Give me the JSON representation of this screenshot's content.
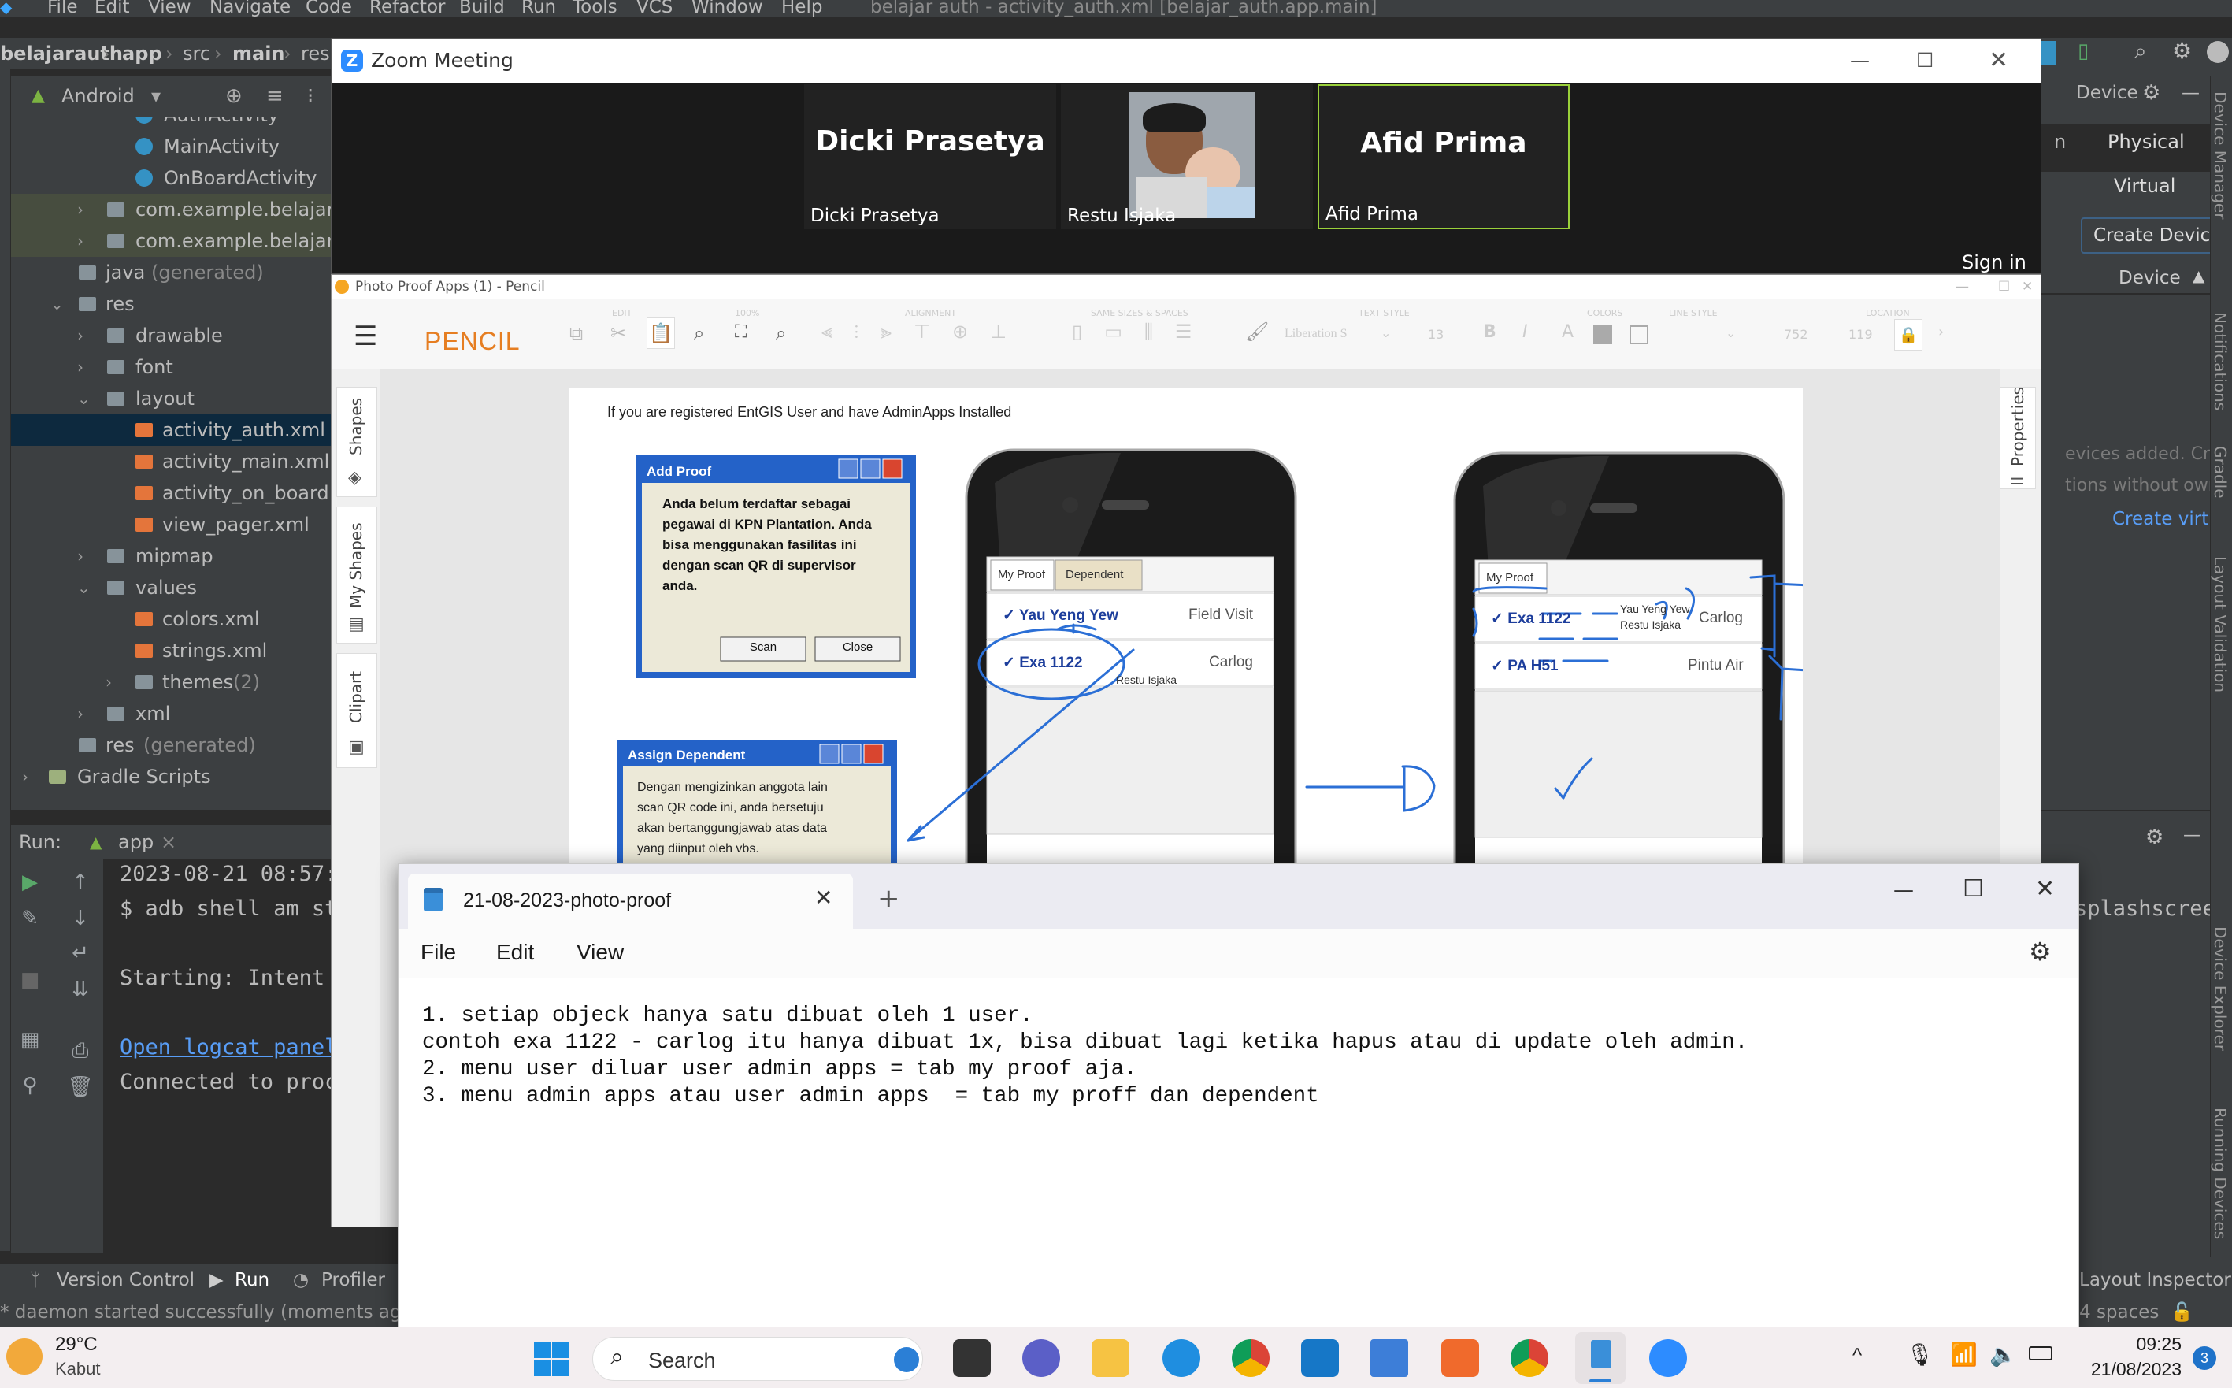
{
  "android_studio": {
    "menu": [
      "File",
      "Edit",
      "View",
      "Navigate",
      "Code",
      "Refactor",
      "Build",
      "Run",
      "Tools",
      "VCS",
      "Window",
      "Help"
    ],
    "window_title": "belajar auth - activity_auth.xml [belajar_auth.app.main]",
    "breadcrumb": [
      "belajarauth",
      "app",
      "src",
      "main",
      "res"
    ],
    "project_view": "Android",
    "tree": [
      {
        "label": "AuthActivity",
        "icon": "class-icon"
      },
      {
        "label": "MainActivity",
        "icon": "class-icon"
      },
      {
        "label": "OnBoardActivity",
        "icon": "class-icon"
      },
      {
        "label": "com.example.belajarauth",
        "icon": "folder-icon"
      },
      {
        "label": "com.example.belajarauth",
        "icon": "folder-icon"
      },
      {
        "label": "java",
        "suffix": "(generated)",
        "icon": "folder-icon"
      },
      {
        "label": "res",
        "icon": "folder-icon"
      },
      {
        "label": "drawable",
        "icon": "folder-icon"
      },
      {
        "label": "font",
        "icon": "folder-icon"
      },
      {
        "label": "layout",
        "icon": "folder-icon"
      },
      {
        "label": "activity_auth.xml",
        "icon": "xml-file-icon"
      },
      {
        "label": "activity_main.xml",
        "icon": "xml-file-icon"
      },
      {
        "label": "activity_on_board.xml",
        "icon": "xml-file-icon"
      },
      {
        "label": "view_pager.xml",
        "icon": "xml-file-icon"
      },
      {
        "label": "mipmap",
        "icon": "folder-icon"
      },
      {
        "label": "values",
        "icon": "folder-icon"
      },
      {
        "label": "colors.xml",
        "icon": "xml-file-icon"
      },
      {
        "label": "strings.xml",
        "icon": "xml-file-icon"
      },
      {
        "label": "themes",
        "suffix": "(2)",
        "icon": "folder-icon"
      },
      {
        "label": "xml",
        "icon": "folder-icon"
      },
      {
        "label": "res",
        "suffix": "(generated)",
        "icon": "folder-icon"
      },
      {
        "label": "Gradle Scripts",
        "icon": "gradle-icon"
      }
    ],
    "run": {
      "label": "Run:",
      "config": "app"
    },
    "console": [
      "2023-08-21 08:57:",
      "$ adb shell am st",
      "Starting: Intent",
      "Open logcat panel",
      "Connected to proc"
    ],
    "console_right": "splashscree",
    "bottom_tabs": [
      "Version Control",
      "Run",
      "Profiler"
    ],
    "bottom_right": "Layout Inspector",
    "status": "* daemon started successfully (moments ago)",
    "status_right": "4 spaces",
    "device_manager": {
      "title": "Device",
      "tabs": [
        "Physical",
        "Virtual"
      ],
      "create_button": "Create Device",
      "column": "Device",
      "empty_text": [
        "evices added. Cre",
        "tions without own"
      ],
      "create_link": "Create virtu"
    },
    "right_strip": [
      "Device Manager",
      "Notifications",
      "Gradle",
      "Layout Validation",
      "Device Explorer",
      "Running Devices"
    ]
  },
  "zoom": {
    "title": "Zoom Meeting",
    "participants": [
      {
        "display": "Dicki Prasetya",
        "label": "Dicki Prasetya",
        "video": false
      },
      {
        "display": "",
        "label": "Restu Isjaka",
        "video": true
      },
      {
        "display": "Afid Prima",
        "label": "Afid Prima",
        "video": false,
        "active": true
      }
    ],
    "sign_in": "Sign in"
  },
  "pencil": {
    "title": "Photo Proof Apps (1) - Pencil",
    "app_name": "PENCIL",
    "toolbar_groups": [
      "EDIT",
      "100%",
      "ALIGNMENT",
      "SAME SIZES & SPACES",
      "TEXT STYLE",
      "COLORS",
      "LINE STYLE",
      "LOCATION"
    ],
    "font": "Liberation S",
    "font_size": "13",
    "location_x": "752",
    "location_y": "119",
    "sidebar_tabs": [
      "Shapes",
      "My Shapes",
      "Clipart"
    ],
    "right_tab": "Properties",
    "canvas": {
      "intro": "If you are registered EntGIS User and have AdminApps Installed",
      "add_proof": {
        "title": "Add Proof",
        "body": [
          "Anda belum terdaftar sebagai",
          "pegawai di KPN Plantation.  Anda",
          "bisa menggunakan fasilitas ini",
          "dengan scan QR di supervisor",
          "anda."
        ],
        "scan": "Scan",
        "close": "Close"
      },
      "assign_dependent": {
        "title": "Assign Dependent",
        "body": [
          "Dengan mengizinkan anggota lain",
          "scan QR code ini, anda bersetuju",
          "akan bertanggungjawab atas data",
          "yang diinput oleh vbs."
        ]
      },
      "phone1": {
        "tabs": [
          "My Proof",
          "Dependent"
        ],
        "rows": [
          {
            "name": "Yau Yeng Yew",
            "value": "Field Visit"
          },
          {
            "name": "Exa 1122",
            "value": "Carlog"
          }
        ],
        "annotation": "Restu Isjaka"
      },
      "phone2": {
        "tabs": [
          "My Proof"
        ],
        "rows": [
          {
            "name": "Exa 1122",
            "value": "Carlog"
          },
          {
            "name": "PA H51",
            "value": "Pintu Air"
          }
        ],
        "annotation": [
          "Yau Yeng Yew",
          "Restu Isjaka"
        ]
      }
    }
  },
  "notepad": {
    "tab_title": "21-08-2023-photo-proof",
    "menu": [
      "File",
      "Edit",
      "View"
    ],
    "lines": [
      "1. setiap objeck hanya satu dibuat oleh 1 user.",
      "contoh exa 1122 - carlog itu hanya dibuat 1x, bisa dibuat lagi ketika hapus atau di update oleh admin.",
      "2. menu user diluar user admin apps = tab my proof aja.",
      "3. menu admin apps atau user admin apps  = tab my proff dan dependent"
    ]
  },
  "taskbar": {
    "weather_temp": "29°C",
    "weather_desc": "Kabut",
    "search": "Search",
    "time": "09:25",
    "date": "21/08/2023",
    "notifications": "3"
  }
}
